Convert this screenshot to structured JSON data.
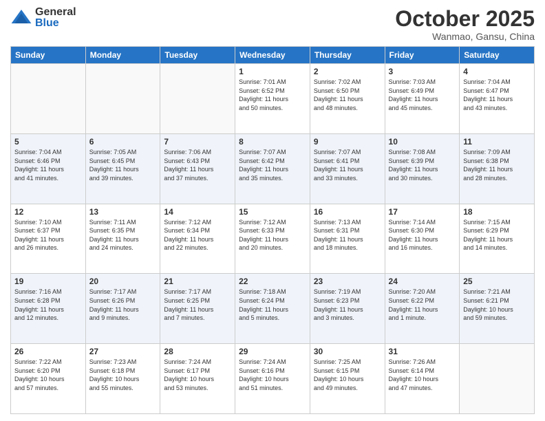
{
  "logo": {
    "general": "General",
    "blue": "Blue"
  },
  "header": {
    "month": "October 2025",
    "location": "Wanmao, Gansu, China"
  },
  "weekdays": [
    "Sunday",
    "Monday",
    "Tuesday",
    "Wednesday",
    "Thursday",
    "Friday",
    "Saturday"
  ],
  "weeks": [
    [
      {
        "day": "",
        "info": ""
      },
      {
        "day": "",
        "info": ""
      },
      {
        "day": "",
        "info": ""
      },
      {
        "day": "1",
        "info": "Sunrise: 7:01 AM\nSunset: 6:52 PM\nDaylight: 11 hours\nand 50 minutes."
      },
      {
        "day": "2",
        "info": "Sunrise: 7:02 AM\nSunset: 6:50 PM\nDaylight: 11 hours\nand 48 minutes."
      },
      {
        "day": "3",
        "info": "Sunrise: 7:03 AM\nSunset: 6:49 PM\nDaylight: 11 hours\nand 45 minutes."
      },
      {
        "day": "4",
        "info": "Sunrise: 7:04 AM\nSunset: 6:47 PM\nDaylight: 11 hours\nand 43 minutes."
      }
    ],
    [
      {
        "day": "5",
        "info": "Sunrise: 7:04 AM\nSunset: 6:46 PM\nDaylight: 11 hours\nand 41 minutes."
      },
      {
        "day": "6",
        "info": "Sunrise: 7:05 AM\nSunset: 6:45 PM\nDaylight: 11 hours\nand 39 minutes."
      },
      {
        "day": "7",
        "info": "Sunrise: 7:06 AM\nSunset: 6:43 PM\nDaylight: 11 hours\nand 37 minutes."
      },
      {
        "day": "8",
        "info": "Sunrise: 7:07 AM\nSunset: 6:42 PM\nDaylight: 11 hours\nand 35 minutes."
      },
      {
        "day": "9",
        "info": "Sunrise: 7:07 AM\nSunset: 6:41 PM\nDaylight: 11 hours\nand 33 minutes."
      },
      {
        "day": "10",
        "info": "Sunrise: 7:08 AM\nSunset: 6:39 PM\nDaylight: 11 hours\nand 30 minutes."
      },
      {
        "day": "11",
        "info": "Sunrise: 7:09 AM\nSunset: 6:38 PM\nDaylight: 11 hours\nand 28 minutes."
      }
    ],
    [
      {
        "day": "12",
        "info": "Sunrise: 7:10 AM\nSunset: 6:37 PM\nDaylight: 11 hours\nand 26 minutes."
      },
      {
        "day": "13",
        "info": "Sunrise: 7:11 AM\nSunset: 6:35 PM\nDaylight: 11 hours\nand 24 minutes."
      },
      {
        "day": "14",
        "info": "Sunrise: 7:12 AM\nSunset: 6:34 PM\nDaylight: 11 hours\nand 22 minutes."
      },
      {
        "day": "15",
        "info": "Sunrise: 7:12 AM\nSunset: 6:33 PM\nDaylight: 11 hours\nand 20 minutes."
      },
      {
        "day": "16",
        "info": "Sunrise: 7:13 AM\nSunset: 6:31 PM\nDaylight: 11 hours\nand 18 minutes."
      },
      {
        "day": "17",
        "info": "Sunrise: 7:14 AM\nSunset: 6:30 PM\nDaylight: 11 hours\nand 16 minutes."
      },
      {
        "day": "18",
        "info": "Sunrise: 7:15 AM\nSunset: 6:29 PM\nDaylight: 11 hours\nand 14 minutes."
      }
    ],
    [
      {
        "day": "19",
        "info": "Sunrise: 7:16 AM\nSunset: 6:28 PM\nDaylight: 11 hours\nand 12 minutes."
      },
      {
        "day": "20",
        "info": "Sunrise: 7:17 AM\nSunset: 6:26 PM\nDaylight: 11 hours\nand 9 minutes."
      },
      {
        "day": "21",
        "info": "Sunrise: 7:17 AM\nSunset: 6:25 PM\nDaylight: 11 hours\nand 7 minutes."
      },
      {
        "day": "22",
        "info": "Sunrise: 7:18 AM\nSunset: 6:24 PM\nDaylight: 11 hours\nand 5 minutes."
      },
      {
        "day": "23",
        "info": "Sunrise: 7:19 AM\nSunset: 6:23 PM\nDaylight: 11 hours\nand 3 minutes."
      },
      {
        "day": "24",
        "info": "Sunrise: 7:20 AM\nSunset: 6:22 PM\nDaylight: 11 hours\nand 1 minute."
      },
      {
        "day": "25",
        "info": "Sunrise: 7:21 AM\nSunset: 6:21 PM\nDaylight: 10 hours\nand 59 minutes."
      }
    ],
    [
      {
        "day": "26",
        "info": "Sunrise: 7:22 AM\nSunset: 6:20 PM\nDaylight: 10 hours\nand 57 minutes."
      },
      {
        "day": "27",
        "info": "Sunrise: 7:23 AM\nSunset: 6:18 PM\nDaylight: 10 hours\nand 55 minutes."
      },
      {
        "day": "28",
        "info": "Sunrise: 7:24 AM\nSunset: 6:17 PM\nDaylight: 10 hours\nand 53 minutes."
      },
      {
        "day": "29",
        "info": "Sunrise: 7:24 AM\nSunset: 6:16 PM\nDaylight: 10 hours\nand 51 minutes."
      },
      {
        "day": "30",
        "info": "Sunrise: 7:25 AM\nSunset: 6:15 PM\nDaylight: 10 hours\nand 49 minutes."
      },
      {
        "day": "31",
        "info": "Sunrise: 7:26 AM\nSunset: 6:14 PM\nDaylight: 10 hours\nand 47 minutes."
      },
      {
        "day": "",
        "info": ""
      }
    ]
  ]
}
